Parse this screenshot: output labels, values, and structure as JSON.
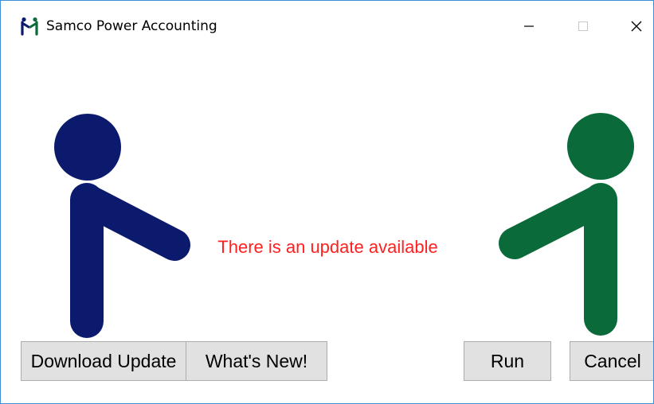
{
  "window": {
    "title": "Samco Power Accounting",
    "border_color": "#3c8fd6"
  },
  "title_controls": {
    "minimize_icon": "minimize-icon",
    "maximize_icon": "maximize-icon",
    "close_icon": "close-icon"
  },
  "main": {
    "message": "There is an update available",
    "message_color": "#ff2020",
    "left_figure_color": "#0c1a6e",
    "right_figure_color": "#0b6a3a"
  },
  "buttons": {
    "download_update": "Download Update",
    "whats_new": "What's New!",
    "run": "Run",
    "cancel": "Cancel"
  }
}
